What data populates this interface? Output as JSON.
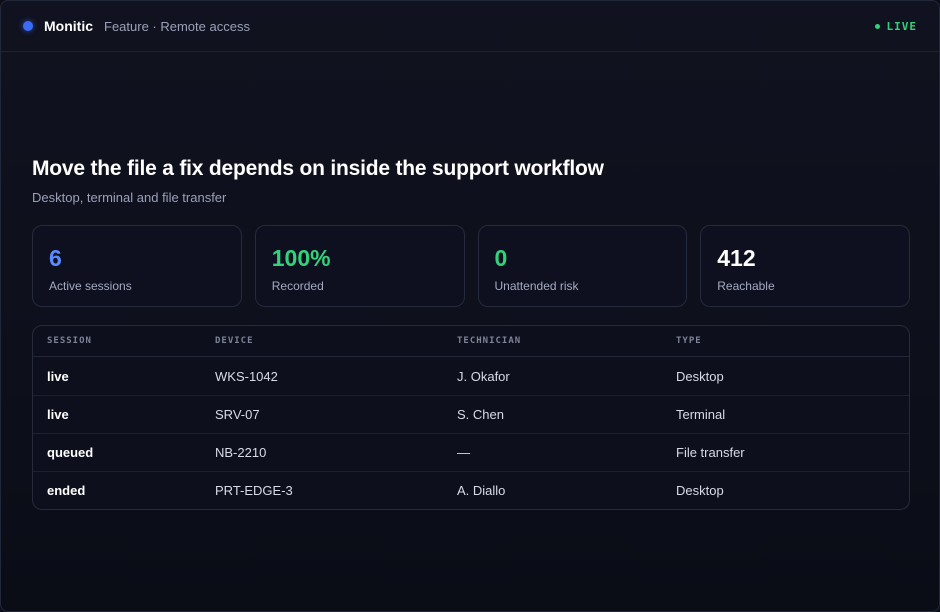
{
  "app": {
    "brand": "Monitic",
    "breadcrumb": "Feature · Remote access",
    "status": "LIVE",
    "colors": {
      "accent": "#3b6cf6",
      "live": "#34d17a"
    }
  },
  "hero": {
    "title": "Move the file a fix depends on inside the support workflow",
    "subtitle": "Desktop, terminal and file transfer"
  },
  "stats": [
    {
      "value": "6",
      "label": "Active sessions",
      "color": "#5b8cff"
    },
    {
      "value": "100%",
      "label": "Recorded",
      "color": "#34d17a"
    },
    {
      "value": "0",
      "label": "Unattended risk",
      "color": "#34d17a"
    },
    {
      "value": "412",
      "label": "Reachable",
      "color": "#ffffff"
    }
  ],
  "table": {
    "columns": [
      "SESSION",
      "DEVICE",
      "TECHNICIAN",
      "TYPE"
    ],
    "rows": [
      {
        "session": "live",
        "device": "WKS-1042",
        "technician": "J. Okafor",
        "type": "Desktop"
      },
      {
        "session": "live",
        "device": "SRV-07",
        "technician": "S. Chen",
        "type": "Terminal"
      },
      {
        "session": "queued",
        "device": "NB-2210",
        "technician": "—",
        "type": "File transfer"
      },
      {
        "session": "ended",
        "device": "PRT-EDGE-3",
        "technician": "A. Diallo",
        "type": "Desktop"
      }
    ]
  }
}
